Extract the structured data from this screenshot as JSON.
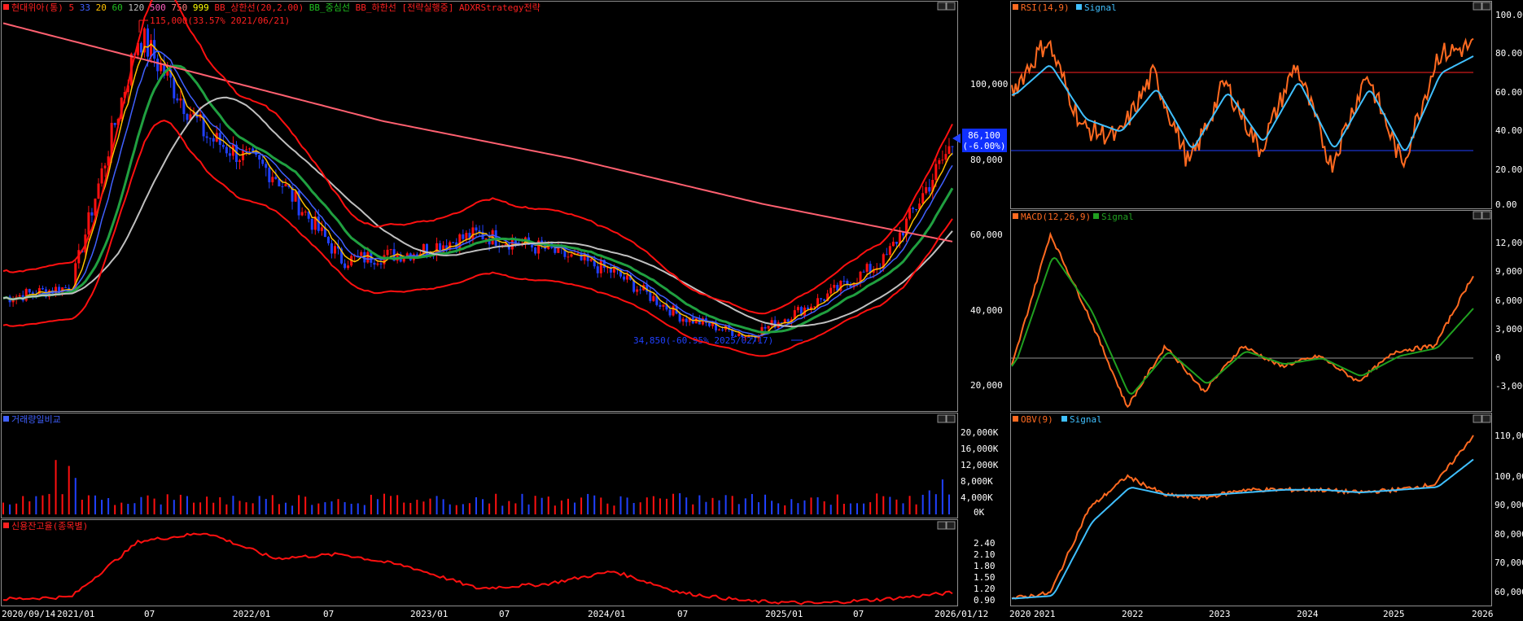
{
  "colors": {
    "bg": "#000000",
    "grid": "#808080",
    "up": "#ff1010",
    "down": "#2040ff",
    "text": "#ffffff"
  },
  "main_panel": {
    "header_items": [
      {
        "text": "현대위아(통)",
        "color": "#ff2020"
      },
      {
        "text": "5",
        "color": "#ff2020"
      },
      {
        "text": "33",
        "color": "#4060ff"
      },
      {
        "text": "20",
        "color": "#ffc000"
      },
      {
        "text": "60",
        "color": "#20c020"
      },
      {
        "text": "120",
        "color": "#c0c0c0"
      },
      {
        "text": "500",
        "color": "#ff60c0"
      },
      {
        "text": "750",
        "color": "#ff8080"
      },
      {
        "text": "999",
        "color": "#ffff00"
      },
      {
        "text": "BB_상한선(20,2.00)",
        "color": "#ff2020"
      },
      {
        "text": "BB_중심선",
        "color": "#20c020"
      },
      {
        "text": "BB_하한선",
        "color": "#ff2020"
      },
      {
        "text": "[전략실행중] ADXRStrategy전략",
        "color": "#ff2020"
      }
    ],
    "annotation_high": "115,000(33.57% 2021/06/21)",
    "annotation_low": "34,850(-60.95% 2025/02/17)",
    "price_tag": "86,100",
    "price_change": "(-6.00%)",
    "y_ticks": [
      "100,000",
      "80,000",
      "60,000",
      "40,000",
      "20,000"
    ]
  },
  "volume_panel": {
    "title": "거래량일비교",
    "y_ticks": [
      "20,000K",
      "16,000K",
      "12,000K",
      "8,000K",
      "4,000K",
      "0K"
    ]
  },
  "credit_panel": {
    "title": "신용잔고율(종목별)",
    "y_ticks": [
      "2.40",
      "2.10",
      "1.80",
      "1.50",
      "1.20",
      "0.90"
    ]
  },
  "x_axis_left": [
    "2020/09/14",
    "2021/01",
    "07",
    "2022/01",
    "07",
    "2023/01",
    "07",
    "2024/01",
    "07",
    "2025/01",
    "07",
    "2026/01/12"
  ],
  "rsi_panel": {
    "title_main": "RSI(14,9)",
    "title_signal": "Signal",
    "y_ticks": [
      "100.00",
      "80.00",
      "60.00",
      "40.00",
      "20.00",
      "0.00"
    ]
  },
  "macd_panel": {
    "title_main": "MACD(12,26,9)",
    "title_signal": "Signal",
    "y_ticks": [
      "12,000",
      "9,000",
      "6,000",
      "3,000",
      "0",
      "-3,000"
    ]
  },
  "obv_panel": {
    "title_main": "OBV(9)",
    "title_signal": "Signal",
    "y_ticks": [
      "110,000K",
      "100,000K",
      "90,000K",
      "80,000K",
      "70,000K",
      "60,000K"
    ]
  },
  "x_axis_right": [
    "2020",
    "2021",
    "2022",
    "2023",
    "2024",
    "2025",
    "2026"
  ],
  "chart_data": [
    {
      "type": "line",
      "title": "현대위아(통) price",
      "x": [
        "2020/09",
        "2021/01",
        "2021/06",
        "2021/07",
        "2022/01",
        "2022/07",
        "2023/01",
        "2023/07",
        "2024/01",
        "2024/07",
        "2025/01",
        "2025/02",
        "2025/07",
        "2025/11",
        "2026/01"
      ],
      "series": [
        {
          "name": "현대위아(통)",
          "values": [
            45000,
            48000,
            115000,
            88000,
            78000,
            55000,
            57000,
            62000,
            58000,
            52000,
            40000,
            34850,
            44000,
            55000,
            86100
          ]
        }
      ],
      "ylim": [
        15000,
        122000
      ]
    },
    {
      "type": "bar",
      "title": "거래량일비교",
      "ylim": [
        0,
        22000
      ],
      "unit": "K"
    },
    {
      "type": "line",
      "title": "신용잔고율(종목별)",
      "ylim": [
        0.8,
        2.7
      ]
    },
    {
      "type": "line",
      "title": "RSI(14,9)",
      "ylim": [
        0,
        100
      ],
      "series": [
        {
          "name": "RSI",
          "values": [
            60,
            88,
            40,
            35,
            70,
            20,
            65,
            28,
            75,
            20,
            70,
            20,
            80,
            85
          ]
        },
        {
          "name": "Signal",
          "values": [
            58,
            75,
            45,
            38,
            62,
            28,
            60,
            32,
            66,
            28,
            62,
            26,
            70,
            80
          ]
        }
      ]
    },
    {
      "type": "line",
      "title": "MACD(12,26,9)",
      "ylim": [
        -4000,
        14000
      ],
      "series": [
        {
          "name": "MACD",
          "values": [
            0,
            13000,
            5000,
            -4000,
            2000,
            -2500,
            2000,
            0,
            1000,
            -1500,
            1500,
            2000,
            9000
          ]
        },
        {
          "name": "Signal",
          "values": [
            0,
            11000,
            5500,
            -3000,
            1500,
            -1800,
            1500,
            200,
            800,
            -1000,
            1000,
            1800,
            6000
          ]
        }
      ]
    },
    {
      "type": "line",
      "title": "OBV(9)",
      "ylim": [
        55000,
        120000
      ],
      "series": [
        {
          "name": "OBV",
          "values": [
            57000,
            59000,
            90000,
            102000,
            95000,
            94000,
            97000,
            97000,
            97000,
            96000,
            97000,
            99000,
            117000
          ]
        },
        {
          "name": "Signal",
          "values": [
            57000,
            58000,
            85000,
            98000,
            95000,
            95000,
            96000,
            97000,
            97000,
            96000,
            97000,
            98000,
            109000
          ]
        }
      ]
    }
  ]
}
